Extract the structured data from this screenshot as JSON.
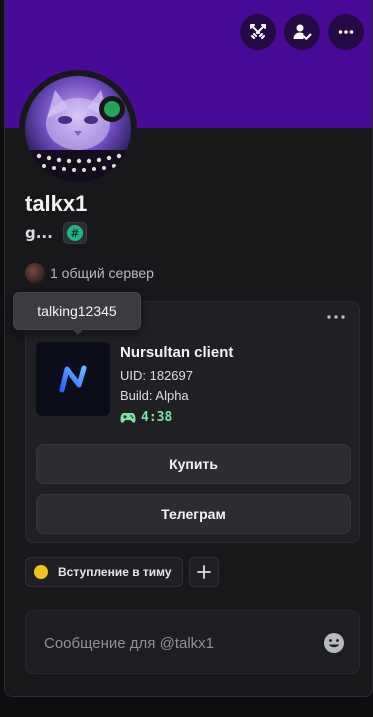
{
  "profile": {
    "username": "talkx1",
    "short_status": "g...",
    "tag_symbol": "#",
    "status": "online",
    "mutual_servers": "1 общий сервер"
  },
  "header_actions": [
    {
      "name": "swords-icon"
    },
    {
      "name": "person-check-icon"
    },
    {
      "name": "more-horizontal-icon"
    }
  ],
  "tooltip": {
    "text": "talking12345"
  },
  "activity": {
    "title": "Nursultan client",
    "uid": "UID: 182697",
    "build": "Build: Alpha",
    "elapsed": "4:38",
    "buy_label": "Купить",
    "telegram_label": "Телеграм"
  },
  "roles": [
    {
      "label": "Вступление в тиму",
      "color": "#f0c419"
    }
  ],
  "message": {
    "placeholder": "Сообщение для @talkx1"
  },
  "colors": {
    "banner": "#4a0a98",
    "online": "#23a55a",
    "timer": "#7ee3a4",
    "tag_badge": "#1fb389"
  }
}
